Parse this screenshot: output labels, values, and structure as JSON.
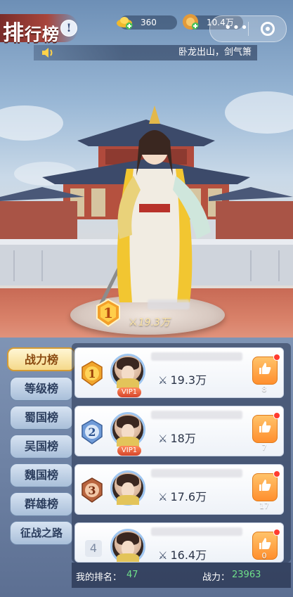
{
  "header": {
    "title_first": "排",
    "title_rest": "行榜",
    "info_icon": "!",
    "currency_1": {
      "icon": "gold-ingot-icon",
      "value": "360"
    },
    "currency_2": {
      "icon": "coin-icon",
      "value": "10.4万"
    },
    "capsule_more": "•••"
  },
  "marquee": {
    "icon": "speaker-icon",
    "text": "卧龙出山，剑气箫"
  },
  "podium": {
    "rank": "1",
    "power": "19.3万",
    "power_icon": "crossed-swords-icon"
  },
  "tabs": [
    {
      "label": "战力榜",
      "active": true
    },
    {
      "label": "等级榜",
      "active": false
    },
    {
      "label": "蜀国榜",
      "active": false
    },
    {
      "label": "吴国榜",
      "active": false
    },
    {
      "label": "魏国榜",
      "active": false
    },
    {
      "label": "群雄榜",
      "active": false
    },
    {
      "label": "征战之路",
      "active": false
    }
  ],
  "rankings": [
    {
      "rank": "1",
      "vip": "VIP1",
      "power": "19.3万",
      "likes": "8"
    },
    {
      "rank": "2",
      "vip": "VIP1",
      "power": "18万",
      "likes": "7"
    },
    {
      "rank": "3",
      "vip": "",
      "power": "17.6万",
      "likes": "17"
    },
    {
      "rank": "4",
      "vip": "",
      "power": "16.4万",
      "likes": "0"
    }
  ],
  "footer": {
    "my_rank_label": "我的排名：",
    "my_rank_value": "47",
    "my_power_label": "战力：",
    "my_power_value": "23963"
  },
  "colors": {
    "gold": "#f5d98a",
    "active_tab_border": "#d49b34",
    "like_orange": "#ff8f2e",
    "footer_value_green": "#6fe08a"
  }
}
